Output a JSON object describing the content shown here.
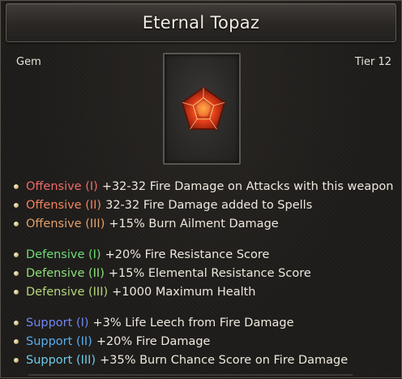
{
  "title": "Eternal Topaz",
  "category": "Gem",
  "tier": "Tier 12",
  "icon": "topaz-gem-icon",
  "colors": {
    "offensive_1": "#ef6b6b",
    "offensive_2": "#f2825e",
    "offensive_3": "#e2a06a",
    "defensive_1": "#6fdc78",
    "defensive_2": "#8ee07a",
    "defensive_3": "#b3d87a",
    "support_1": "#6f87f1",
    "support_2": "#58aef0",
    "support_3": "#6ecbe8",
    "gem": "#e4401a"
  },
  "stats": [
    {
      "group": "Offensive",
      "tier": "(I)",
      "text": "+32-32 Fire Damage on Attacks with this weapon"
    },
    {
      "group": "Offensive",
      "tier": "(II)",
      "text": "32-32 Fire Damage added to Spells"
    },
    {
      "group": "Offensive",
      "tier": "(III)",
      "text": "+15% Burn Ailment Damage"
    },
    {
      "group": "Defensive",
      "tier": "(I)",
      "text": "+20% Fire Resistance Score"
    },
    {
      "group": "Defensive",
      "tier": "(II)",
      "text": "+15% Elemental Resistance Score"
    },
    {
      "group": "Defensive",
      "tier": "(III)",
      "text": "+1000 Maximum Health"
    },
    {
      "group": "Support",
      "tier": "(I)",
      "text": "+3% Life Leech from Fire Damage"
    },
    {
      "group": "Support",
      "tier": "(II)",
      "text": "+20% Fire Damage"
    },
    {
      "group": "Support",
      "tier": "(III)",
      "text": "+35% Burn Chance Score on Fire Damage"
    }
  ]
}
